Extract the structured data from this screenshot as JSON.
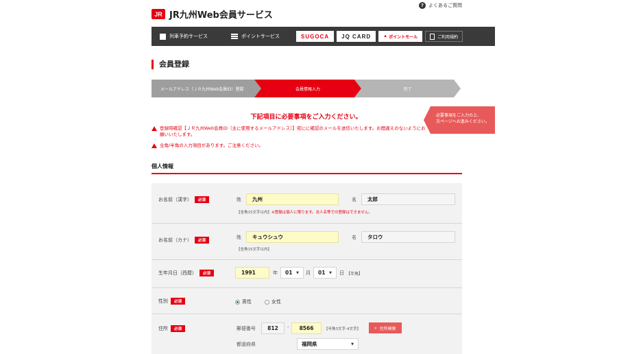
{
  "header": {
    "logo_mark": "JR",
    "logo_text": "JR九州Web会員サービス",
    "faq_label": "よくあるご質問",
    "faq_icon": "question-circle-icon"
  },
  "nav": {
    "train": "列車予約サービス",
    "points": "ポイントサービス",
    "sugoca": "SUGOCA",
    "jqcard": "JQ CARD",
    "pointmall": "ポイントモール",
    "terms": "ご利用規約"
  },
  "page_title": "会員登録",
  "steps": {
    "step1": "メールアドレス（ＪＲ九州Web会員ID）登録",
    "step2": "会員情報入力",
    "step3": "完了"
  },
  "notice": {
    "title": "下記項目に必要事項をご入力ください。",
    "side_tag_line1": "必要事項をご入力の上、",
    "side_tag_line2": "次ページへお進みください。",
    "warn1": "登録時確認【ＪＲ九州Web会員ID（主に使用するメールアドレス）】宛にに確認のメールを送信いたします。お間違えのないようにお願いいたします。",
    "warn2": "全角/半角の入力項目があります。ご注意ください。"
  },
  "section": {
    "title": "個人情報"
  },
  "form": {
    "required": "必須",
    "name_kanji": {
      "label": "お名前（漢字）",
      "sei_label": "姓",
      "sei_value": "九州",
      "mei_label": "名",
      "mei_value": "太郎",
      "hint": "【全角15文字以内】",
      "hint_red": "※登録は個人に限ります。法人名等での登録はできません。"
    },
    "name_kana": {
      "label": "お名前（カナ）",
      "sei_label": "姓",
      "sei_value": "キュウシュウ",
      "mei_label": "名",
      "mei_value": "タロウ",
      "hint": "【全角15文字以内】"
    },
    "birthday": {
      "label": "生年月日（西暦）",
      "year_value": "1991",
      "year_unit": "年",
      "month_value": "01",
      "month_unit": "月",
      "day_value": "01",
      "day_unit": "日",
      "note": "【半角】"
    },
    "gender": {
      "label": "性別",
      "male": "男性",
      "female": "女性",
      "selected": "男性"
    },
    "address": {
      "label": "住所",
      "postal_label": "郵便番号",
      "postal1": "812",
      "postal_sep": "-",
      "postal2": "8566",
      "postal_hint": "【半角3文字-4文字】",
      "search_button": "住所検索",
      "pref_label": "都道府県",
      "pref_value": "福岡県"
    }
  },
  "colors": {
    "accent": "#e60012",
    "navbar": "#3a3a3a",
    "input_highlight": "#fdfbc8"
  }
}
